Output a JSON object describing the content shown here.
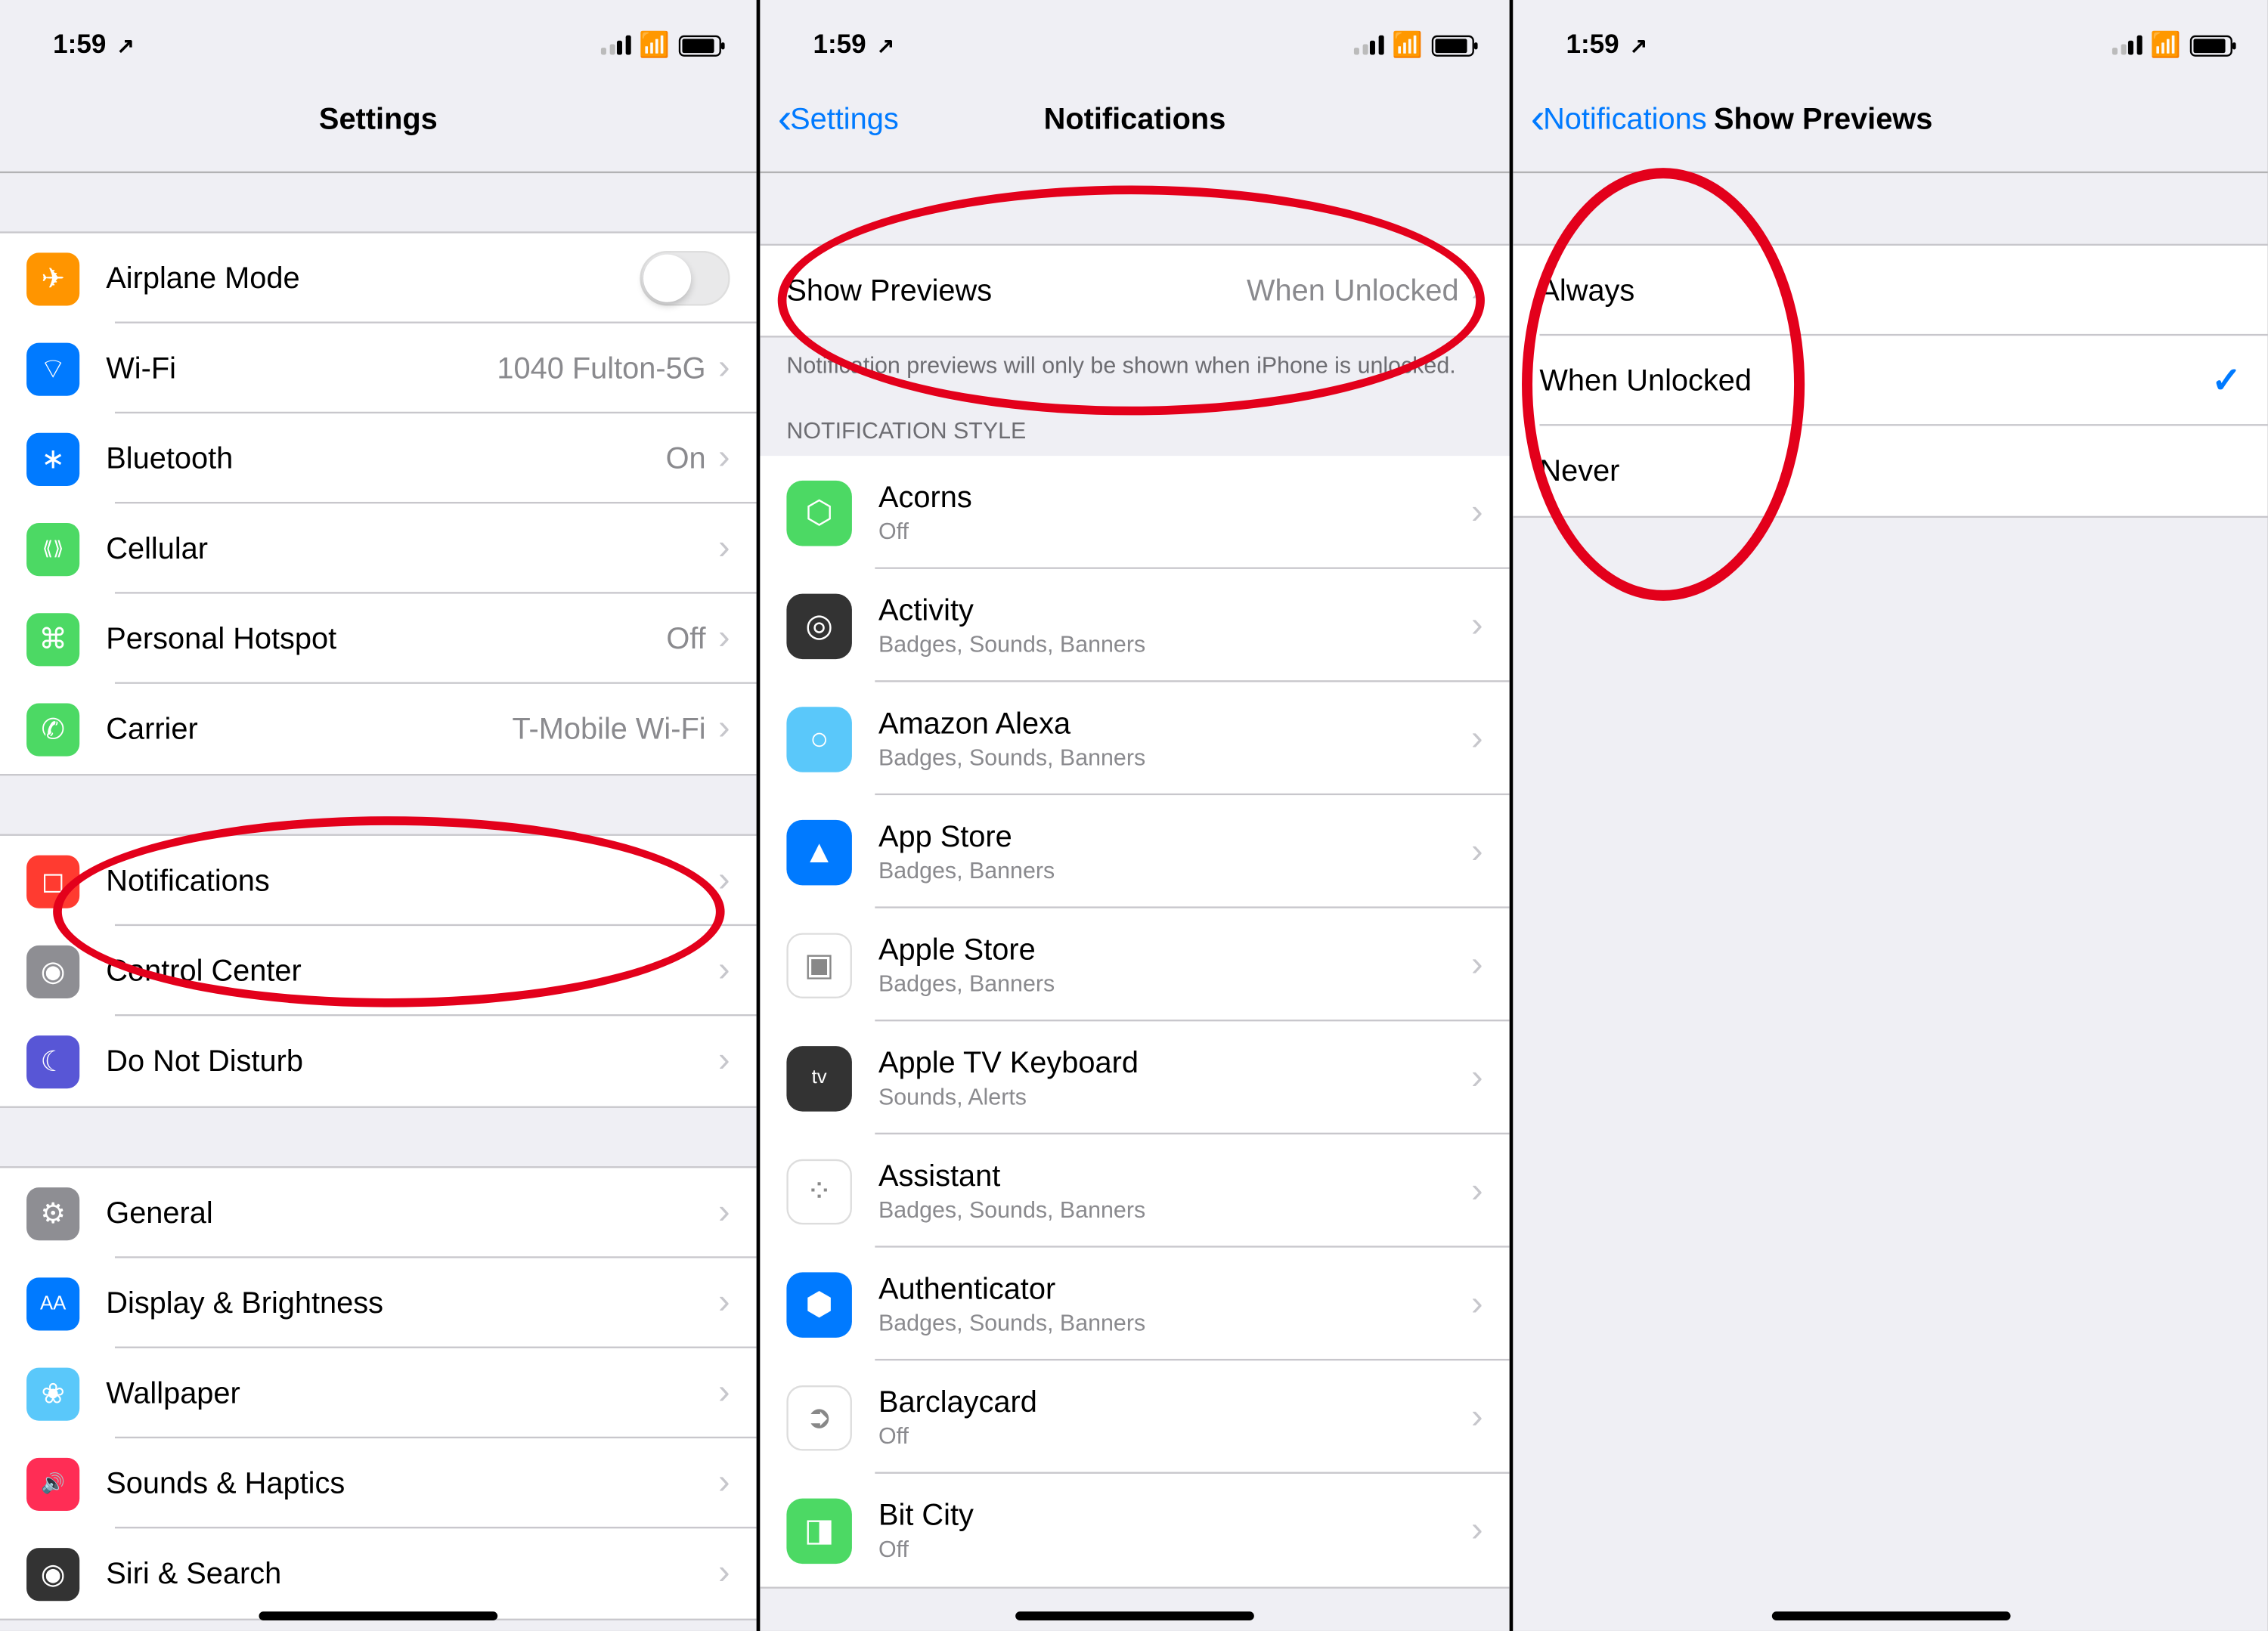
{
  "statusbar": {
    "time": "1:59",
    "location_icon": "➤"
  },
  "panel1": {
    "title": "Settings",
    "group_a": [
      {
        "label": "Airplane Mode",
        "value": "",
        "type": "toggle",
        "icon": "bg-orange",
        "glyph": "✈"
      },
      {
        "label": "Wi-Fi",
        "value": "1040 Fulton-5G",
        "type": "link",
        "icon": "bg-blue",
        "glyph": "⌔"
      },
      {
        "label": "Bluetooth",
        "value": "On",
        "type": "link",
        "icon": "bg-blue",
        "glyph": "∗"
      },
      {
        "label": "Cellular",
        "value": "",
        "type": "link",
        "icon": "bg-green",
        "glyph": "⟪⟫"
      },
      {
        "label": "Personal Hotspot",
        "value": "Off",
        "type": "link",
        "icon": "bg-green",
        "glyph": "⌘"
      },
      {
        "label": "Carrier",
        "value": "T-Mobile Wi-Fi",
        "type": "link",
        "icon": "bg-green",
        "glyph": "✆"
      }
    ],
    "group_b": [
      {
        "label": "Notifications",
        "value": "",
        "type": "link",
        "icon": "bg-red",
        "glyph": "◻"
      },
      {
        "label": "Control Center",
        "value": "",
        "type": "link",
        "icon": "bg-grey",
        "glyph": "◉"
      },
      {
        "label": "Do Not Disturb",
        "value": "",
        "type": "link",
        "icon": "bg-purple",
        "glyph": "☾"
      }
    ],
    "group_c": [
      {
        "label": "General",
        "value": "",
        "type": "link",
        "icon": "bg-grey",
        "glyph": "⚙"
      },
      {
        "label": "Display & Brightness",
        "value": "",
        "type": "link",
        "icon": "bg-blue",
        "glyph": "AA"
      },
      {
        "label": "Wallpaper",
        "value": "",
        "type": "link",
        "icon": "bg-bluealt",
        "glyph": "❀"
      },
      {
        "label": "Sounds & Haptics",
        "value": "",
        "type": "link",
        "icon": "bg-pink",
        "glyph": "🔊"
      },
      {
        "label": "Siri & Search",
        "value": "",
        "type": "link",
        "icon": "bg-dark",
        "glyph": "◉"
      }
    ]
  },
  "panel2": {
    "back": "Settings",
    "title": "Notifications",
    "previews_row": {
      "label": "Show Previews",
      "value": "When Unlocked"
    },
    "footer": "Notification previews will only be shown when iPhone is unlocked.",
    "section_header": "NOTIFICATION STYLE",
    "apps": [
      {
        "label": "Acorns",
        "sub": "Off",
        "glyph": "⬡",
        "icon": "bg-green"
      },
      {
        "label": "Activity",
        "sub": "Badges, Sounds, Banners",
        "glyph": "◎",
        "icon": "bg-dark"
      },
      {
        "label": "Amazon Alexa",
        "sub": "Badges, Sounds, Banners",
        "glyph": "○",
        "icon": "bg-bluealt"
      },
      {
        "label": "App Store",
        "sub": "Badges, Banners",
        "glyph": "▲",
        "icon": "bg-blue"
      },
      {
        "label": "Apple Store",
        "sub": "Badges, Banners",
        "glyph": "▣",
        "icon": "bg-white"
      },
      {
        "label": "Apple TV Keyboard",
        "sub": "Sounds, Alerts",
        "glyph": "tv",
        "icon": "bg-dark"
      },
      {
        "label": "Assistant",
        "sub": "Badges, Sounds, Banners",
        "glyph": "⁘",
        "icon": "bg-white"
      },
      {
        "label": "Authenticator",
        "sub": "Badges, Sounds, Banners",
        "glyph": "⬢",
        "icon": "bg-blue"
      },
      {
        "label": "Barclaycard",
        "sub": "Off",
        "glyph": "➲",
        "icon": "bg-white"
      },
      {
        "label": "Bit City",
        "sub": "Off",
        "glyph": "◨",
        "icon": "bg-green"
      }
    ]
  },
  "panel3": {
    "back": "Notifications",
    "title": "Show Previews",
    "options": [
      {
        "label": "Always",
        "selected": false
      },
      {
        "label": "When Unlocked",
        "selected": true
      },
      {
        "label": "Never",
        "selected": false
      }
    ]
  }
}
